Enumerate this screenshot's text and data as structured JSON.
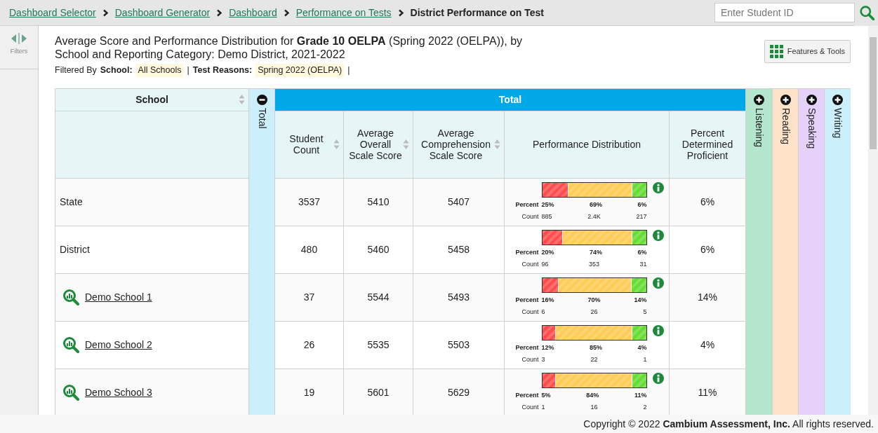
{
  "breadcrumb": [
    {
      "label": "Dashboard Selector",
      "current": false
    },
    {
      "label": "Dashboard Generator",
      "current": false
    },
    {
      "label": "Dashboard",
      "current": false
    },
    {
      "label": "Performance on Tests",
      "current": false
    },
    {
      "label": "District Performance on Test",
      "current": true
    }
  ],
  "search": {
    "placeholder": "Enter Student ID"
  },
  "sidebar": {
    "label": "Filters"
  },
  "title": "Average Score and Performance Distribution for **Grade 10 OELPA** (Spring 2022 (OELPA)), by School and Reporting Category: Demo District, 2021-2022",
  "filters": {
    "label": "Filtered By",
    "separator": "|",
    "items": [
      {
        "name": "School:",
        "value": "All Schools"
      },
      {
        "name": "Test Reasons:",
        "value": "Spring 2022 (OELPA)"
      }
    ]
  },
  "features_button": "Features & Tools",
  "table": {
    "school_header": "School",
    "total_column": {
      "label": "Total",
      "expanded": true,
      "color": "#cceffc"
    },
    "group_header": "Total",
    "columns": [
      {
        "label": "Student Count",
        "sortable": true
      },
      {
        "label": "Average Overall Scale Score",
        "sortable": true
      },
      {
        "label": "Average Comprehension Scale Score",
        "sortable": true
      },
      {
        "label": "Performance Distribution",
        "sortable": false
      },
      {
        "label": "Percent Determined Proficient",
        "sortable": false
      }
    ],
    "categories": [
      {
        "label": "Listening",
        "expanded": false,
        "color": "#b3e6cc"
      },
      {
        "label": "Reading",
        "expanded": false,
        "color": "#ffe3c9"
      },
      {
        "label": "Speaking",
        "expanded": false,
        "color": "#e6d1f8"
      },
      {
        "label": "Writing",
        "expanded": false,
        "color": "#cceffc"
      }
    ],
    "rows": [
      {
        "school": "State",
        "link": false,
        "student_count": "3537",
        "avg_overall": "5410",
        "avg_comprehension": "5407",
        "percent_label": "Percent",
        "count_label": "Count",
        "segments": [
          {
            "percent": "25%",
            "count": "885",
            "color": "#ff4d4d"
          },
          {
            "percent": "69%",
            "count": "2.4K",
            "color": "#ffcc55"
          },
          {
            "percent": "6%",
            "count": "217",
            "color": "#66dd33"
          }
        ],
        "proficient": "6%"
      },
      {
        "school": "District",
        "link": false,
        "student_count": "480",
        "avg_overall": "5460",
        "avg_comprehension": "5458",
        "percent_label": "Percent",
        "count_label": "Count",
        "segments": [
          {
            "percent": "20%",
            "count": "96",
            "color": "#ff4d4d"
          },
          {
            "percent": "74%",
            "count": "353",
            "color": "#ffcc55"
          },
          {
            "percent": "6%",
            "count": "31",
            "color": "#66dd33"
          }
        ],
        "proficient": "6%"
      },
      {
        "school": "Demo School 1",
        "link": true,
        "student_count": "37",
        "avg_overall": "5544",
        "avg_comprehension": "5493",
        "percent_label": "Percent",
        "count_label": "Count",
        "segments": [
          {
            "percent": "16%",
            "count": "6",
            "color": "#ff4d4d"
          },
          {
            "percent": "70%",
            "count": "26",
            "color": "#ffcc55"
          },
          {
            "percent": "14%",
            "count": "5",
            "color": "#66dd33"
          }
        ],
        "proficient": "14%"
      },
      {
        "school": "Demo School 2",
        "link": true,
        "student_count": "26",
        "avg_overall": "5535",
        "avg_comprehension": "5503",
        "percent_label": "Percent",
        "count_label": "Count",
        "segments": [
          {
            "percent": "12%",
            "count": "3",
            "color": "#ff4d4d"
          },
          {
            "percent": "85%",
            "count": "22",
            "color": "#ffcc55"
          },
          {
            "percent": "4%",
            "count": "1",
            "color": "#66dd33"
          }
        ],
        "proficient": "4%"
      },
      {
        "school": "Demo School 3",
        "link": true,
        "student_count": "19",
        "avg_overall": "5601",
        "avg_comprehension": "5629",
        "percent_label": "Percent",
        "count_label": "Count",
        "segments": [
          {
            "percent": "5%",
            "count": "1",
            "color": "#ff4d4d"
          },
          {
            "percent": "84%",
            "count": "16",
            "color": "#ffcc55"
          },
          {
            "percent": "11%",
            "count": "2",
            "color": "#66dd33"
          }
        ],
        "proficient": "11%"
      }
    ]
  },
  "footer": "Copyright © 2022 **Cambium Assessment, Inc.** All rights reserved."
}
